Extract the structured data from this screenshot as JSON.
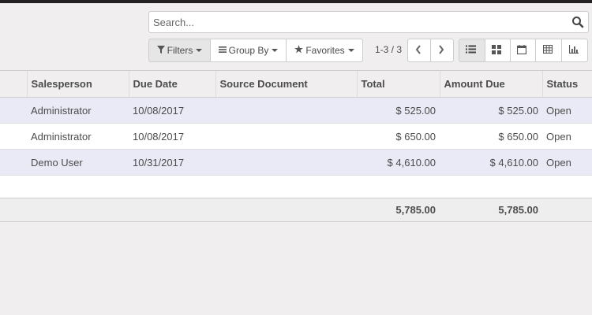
{
  "search": {
    "placeholder": "Search..."
  },
  "filters": {
    "filters_label": "Filters",
    "groupby_label": "Group By",
    "favorites_label": "Favorites"
  },
  "pager": {
    "value": "1-3 / 3"
  },
  "table": {
    "columns": [
      "Salesperson",
      "Due Date",
      "Source Document",
      "Total",
      "Amount Due",
      "Status"
    ],
    "rows": [
      {
        "salesperson": "Administrator",
        "due_date": "10/08/2017",
        "source_document": "",
        "total": "$ 525.00",
        "amount_due": "$ 525.00",
        "status": "Open"
      },
      {
        "salesperson": "Administrator",
        "due_date": "10/08/2017",
        "source_document": "",
        "total": "$ 650.00",
        "amount_due": "$ 650.00",
        "status": "Open"
      },
      {
        "salesperson": "Demo User",
        "due_date": "10/31/2017",
        "source_document": "",
        "total": "$ 4,610.00",
        "amount_due": "$ 4,610.00",
        "status": "Open"
      }
    ],
    "totals": {
      "total": "5,785.00",
      "amount_due": "5,785.00"
    }
  },
  "icons": {
    "search": "search-icon",
    "filter": "filter-icon",
    "group_by": "bars-icon",
    "favorites": "star-icon",
    "prev": "chevron-left-icon",
    "next": "chevron-right-icon",
    "list_view": "list-icon",
    "kanban_view": "kanban-icon",
    "calendar_view": "calendar-icon",
    "pivot_view": "table-icon",
    "graph_view": "bar-chart-icon"
  }
}
